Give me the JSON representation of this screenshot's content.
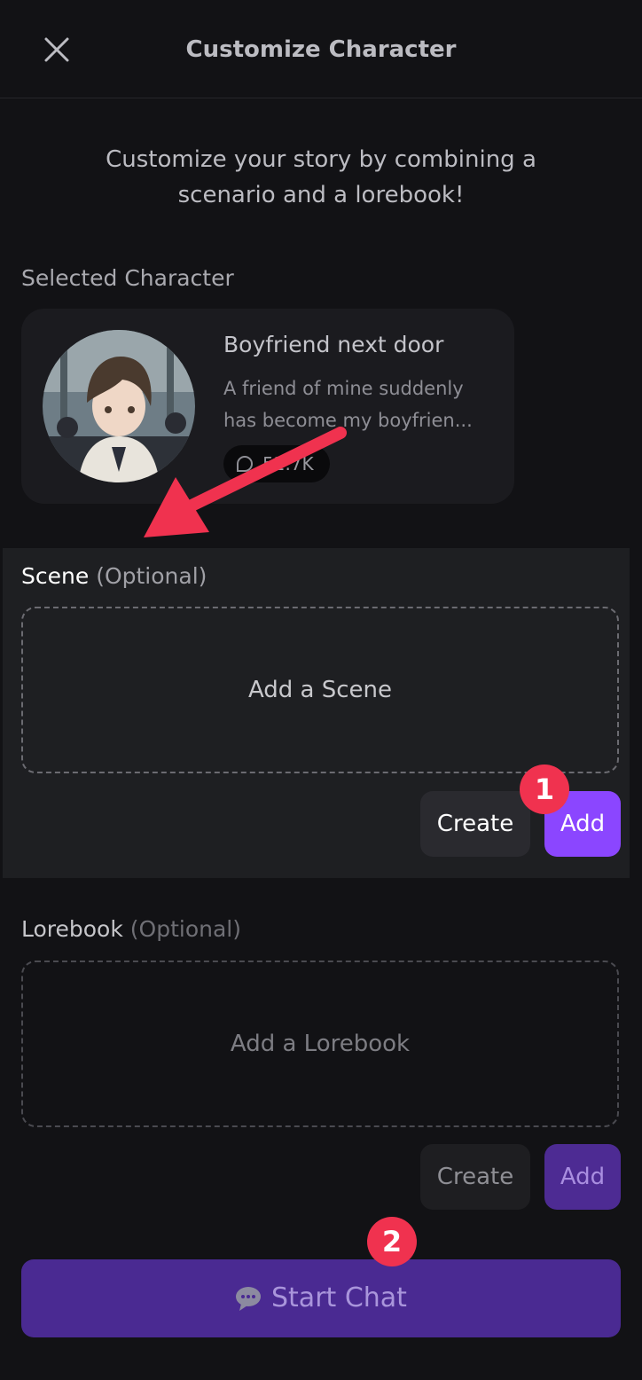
{
  "header": {
    "title": "Customize Character"
  },
  "intro": "Customize your story by combining a scenario and a lorebook!",
  "selected": {
    "label": "Selected Character",
    "name": "Boyfriend next door",
    "description": "A friend of mine suddenly has become my boyfrien...",
    "stat": "52.7K"
  },
  "scene": {
    "label": "Scene",
    "optional": "(Optional)",
    "placeholder": "Add a Scene",
    "create": "Create",
    "add": "Add"
  },
  "lorebook": {
    "label": "Lorebook",
    "optional": "(Optional)",
    "placeholder": "Add a Lorebook",
    "create": "Create",
    "add": "Add"
  },
  "start_chat": "Start Chat",
  "annotations": {
    "step1": "1",
    "step2": "2"
  },
  "colors": {
    "accent": "#8b46ff",
    "accent_dim": "#4a2a92",
    "marker": "#f0324f",
    "arrow": "#f0324f"
  }
}
